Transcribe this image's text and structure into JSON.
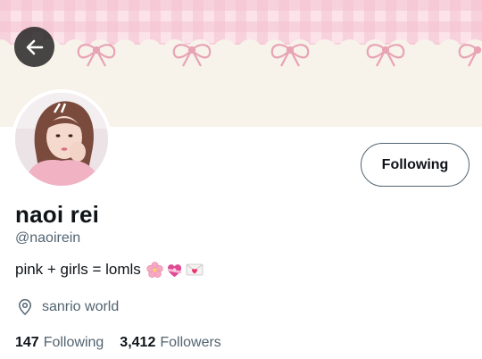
{
  "profile": {
    "name": "naoi rei",
    "handle": "@naoirein",
    "bio": "pink + girls = lomls",
    "bio_emojis": [
      "cherry-blossom-icon",
      "heart-with-ribbon-icon",
      "love-letter-icon"
    ],
    "location": "sanrio world",
    "follow_button": "Following",
    "following_count": "147",
    "following_label": "Following",
    "followers_count": "3,412",
    "followers_label": "Followers"
  },
  "colors": {
    "banner_pink": "#f7cfd8",
    "banner_cream": "#f7f2ea",
    "bow": "#e8a3b4",
    "muted_text": "#536471",
    "primary_text": "#0f1419"
  }
}
